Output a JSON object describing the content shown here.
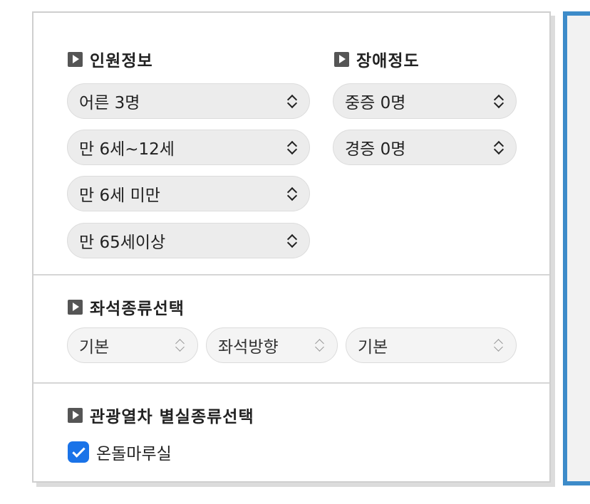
{
  "sections": {
    "passengers": {
      "title": "인원정보",
      "selects": [
        {
          "value": "어른 3명"
        },
        {
          "value": "만 6세~12세"
        },
        {
          "value": "만 6세 미만"
        },
        {
          "value": "만 65세이상"
        }
      ]
    },
    "disability": {
      "title": "장애정도",
      "selects": [
        {
          "value": "중증 0명"
        },
        {
          "value": "경증 0명"
        }
      ]
    },
    "seat_type": {
      "title": "좌석종류선택",
      "selects": [
        {
          "value": "기본"
        },
        {
          "value": "좌석방향"
        },
        {
          "value": "기본"
        }
      ]
    },
    "tour_train": {
      "title": "관광열차 별실종류선택",
      "checkbox_label": "온돌마루실",
      "checked": true
    }
  },
  "colors": {
    "accent_blue": "#3d8bc9",
    "checkbox_blue": "#1a73e8"
  }
}
